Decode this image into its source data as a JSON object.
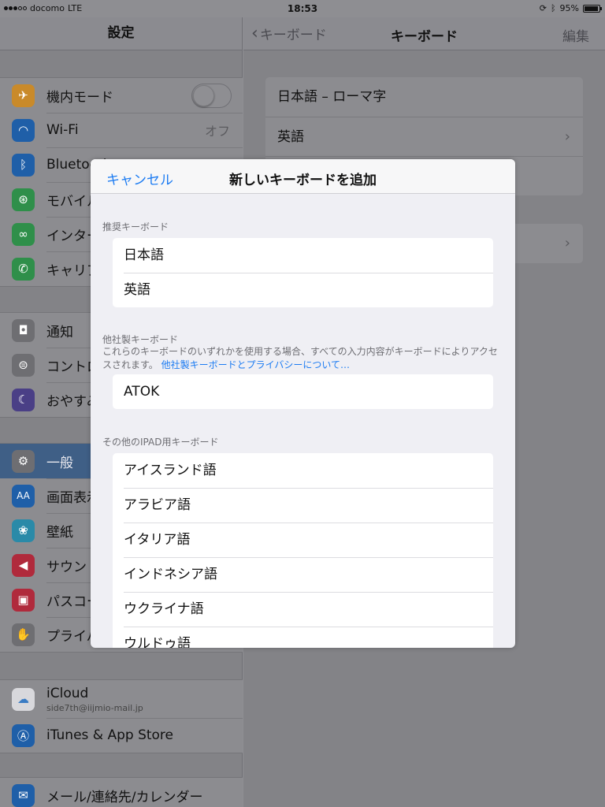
{
  "status_bar": {
    "carrier": "docomo",
    "network": "LTE",
    "time": "18:53",
    "battery": "95%",
    "battery_level": 0.95
  },
  "left_panel": {
    "title": "設定",
    "group1": [
      {
        "label": "機内モード",
        "icon": "airplane-icon",
        "color": "#c98a2a",
        "toggle": false
      },
      {
        "label": "Wi-Fi",
        "icon": "wifi-icon",
        "color": "#1f5fa8",
        "value": "オフ"
      },
      {
        "label": "Bluetooth",
        "icon": "bluetooth-icon",
        "color": "#1f5fa8"
      },
      {
        "label": "モバイルデータ通信",
        "icon": "antenna-icon",
        "color": "#2f8f4a"
      },
      {
        "label": "インターネット共有",
        "icon": "link-icon",
        "color": "#2f8f4a"
      },
      {
        "label": "キャリア",
        "icon": "phone-icon",
        "color": "#2f8f4a"
      }
    ],
    "group2": [
      {
        "label": "通知",
        "icon": "notification-icon",
        "color": "#6e6e72"
      },
      {
        "label": "コントロールセンター",
        "icon": "toggles-icon",
        "color": "#6e6e72"
      },
      {
        "label": "おやすみモード",
        "icon": "moon-icon",
        "color": "#4a3f86"
      }
    ],
    "group3": [
      {
        "label": "一般",
        "icon": "gear-icon",
        "color": "#6e6e72",
        "selected": true
      },
      {
        "label": "画面表示と明るさ",
        "icon": "text-size-icon",
        "color": "#1f5fa8"
      },
      {
        "label": "壁紙",
        "icon": "flower-icon",
        "color": "#2a8aa8"
      },
      {
        "label": "サウンド",
        "icon": "speaker-icon",
        "color": "#b02a3c"
      },
      {
        "label": "パスコード",
        "icon": "lock-icon",
        "color": "#b02a3c"
      },
      {
        "label": "プライバシー",
        "icon": "hand-icon",
        "color": "#6e6e72"
      }
    ],
    "group4": [
      {
        "label": "iCloud",
        "sub": "side7th@iijmio-mail.jp",
        "icon": "cloud-icon",
        "color": "#d8d8dc"
      },
      {
        "label": "iTunes & App Store",
        "icon": "app-store-icon",
        "color": "#1f5fa8"
      }
    ],
    "group5": [
      {
        "label": "メール/連絡先/カレンダー",
        "icon": "mail-icon",
        "color": "#1f5fa8"
      }
    ]
  },
  "right_panel": {
    "back_label": "キーボード",
    "title": "キーボード",
    "edit_label": "編集",
    "keyboards": [
      "日本語 – ローマ字",
      "英語",
      ""
    ],
    "other_row": ""
  },
  "modal": {
    "cancel_label": "キャンセル",
    "title": "新しいキーボードを追加",
    "suggested_header": "推奨キーボード",
    "suggested": [
      "日本語",
      "英語"
    ],
    "third_party_header": "他社製キーボード",
    "third_party_note": "これらのキーボードのいずれかを使用する場合、すべての入力内容がキーボードによりアクセスされます。",
    "third_party_link": "他社製キーボードとプライバシーについて…",
    "third_party": [
      "ATOK"
    ],
    "other_header": "その他のIPAD用キーボード",
    "other": [
      "アイスランド語",
      "アラビア語",
      "イタリア語",
      "インドネシア語",
      "ウクライナ語",
      "ウルドゥ語"
    ]
  }
}
